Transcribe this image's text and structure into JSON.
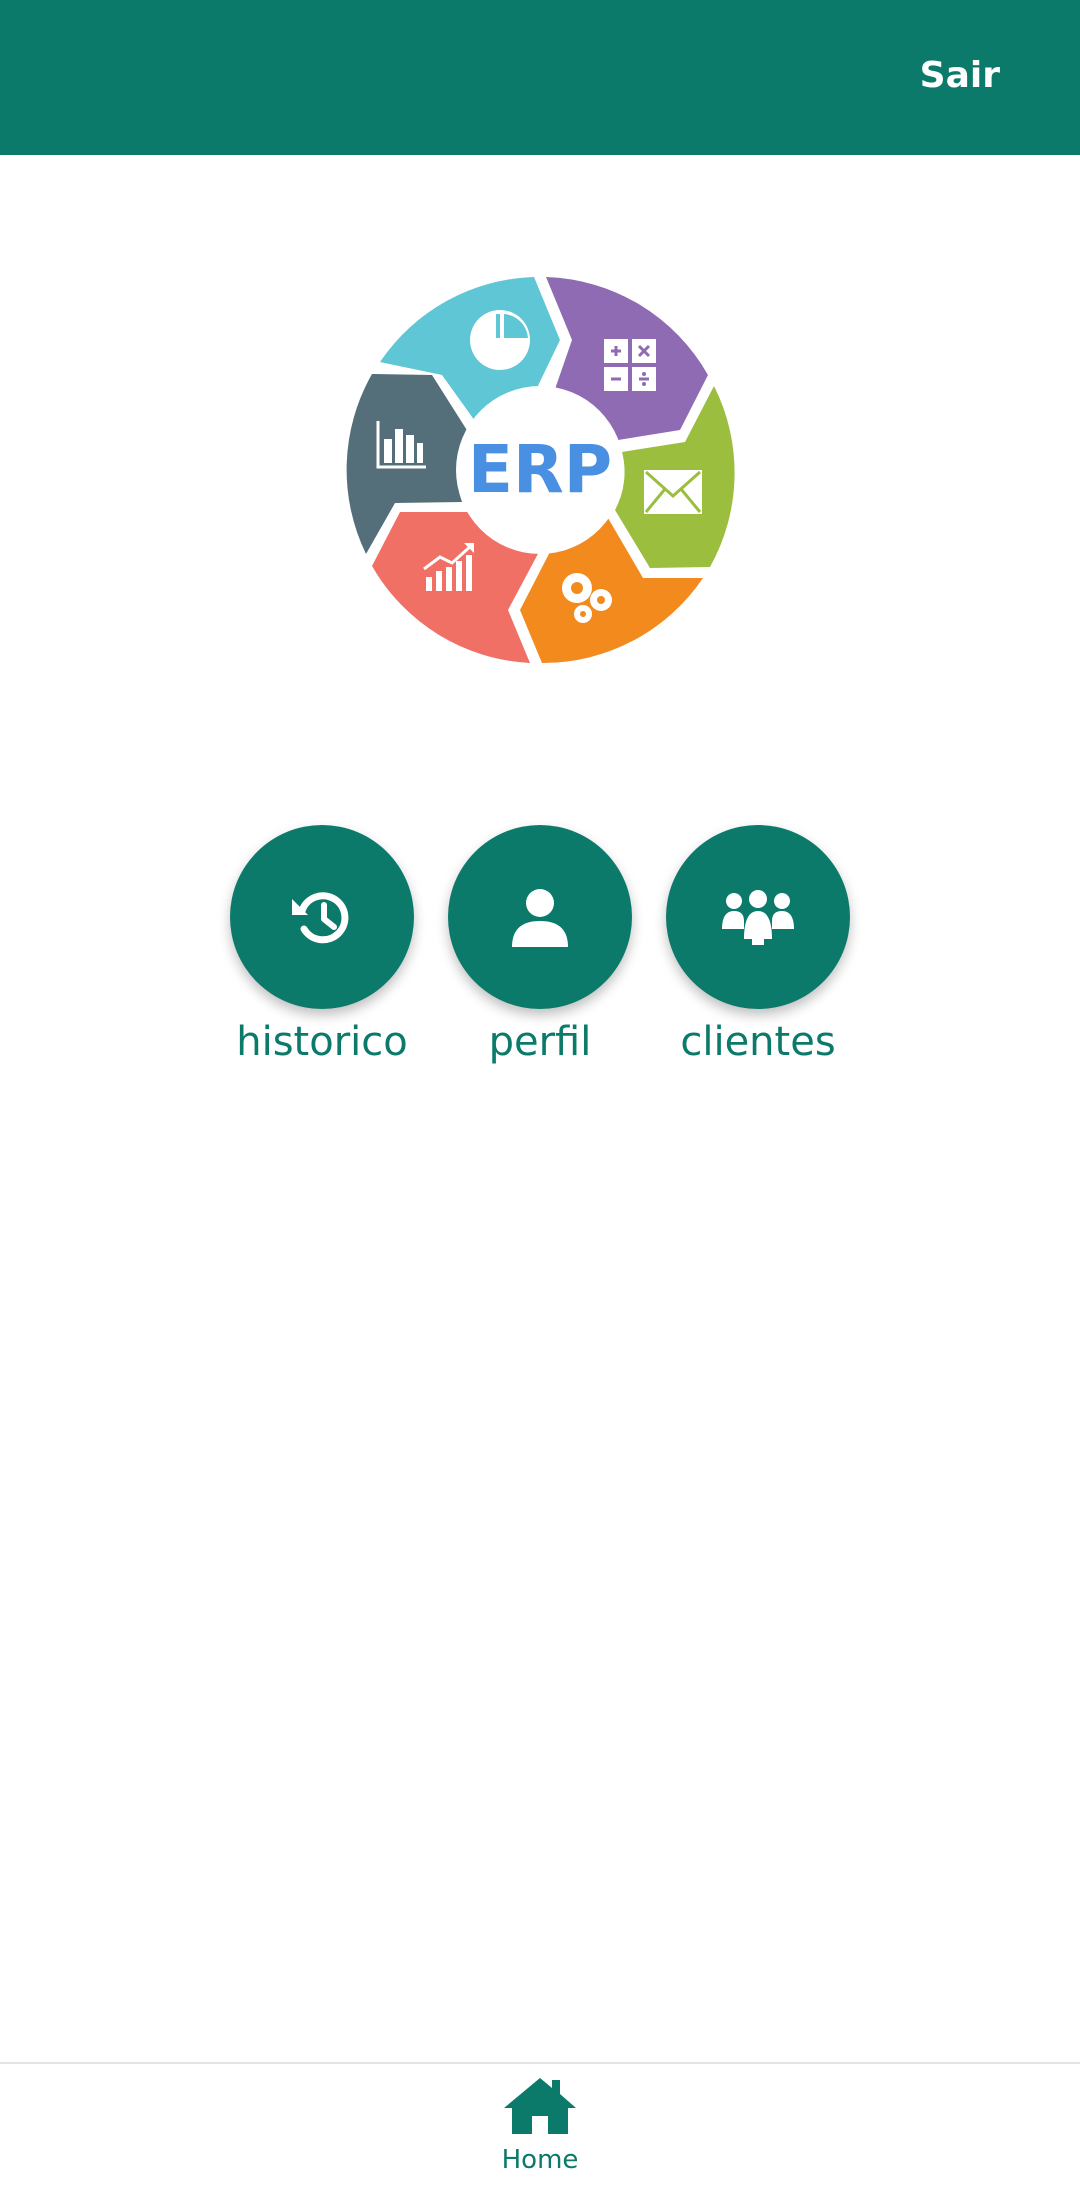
{
  "header": {
    "logout_label": "Sair"
  },
  "logo": {
    "text": "ERP",
    "segments": [
      {
        "name": "pie-chart-icon",
        "color": "#5ec6d4"
      },
      {
        "name": "calculator-icon",
        "color": "#8e6bb3"
      },
      {
        "name": "envelope-icon",
        "color": "#9bbe3f"
      },
      {
        "name": "gears-icon",
        "color": "#f28a1e"
      },
      {
        "name": "growth-chart-icon",
        "color": "#f07066"
      },
      {
        "name": "bar-chart-icon",
        "color": "#546e7a"
      }
    ]
  },
  "actions": [
    {
      "label": "historico",
      "icon": "history-icon"
    },
    {
      "label": "perfil",
      "icon": "user-icon"
    },
    {
      "label": "clientes",
      "icon": "users-group-icon"
    }
  ],
  "bottom_nav": {
    "items": [
      {
        "label": "Home",
        "icon": "home-icon"
      }
    ]
  },
  "colors": {
    "primary": "#0b7a6a",
    "background": "#ffffff"
  }
}
